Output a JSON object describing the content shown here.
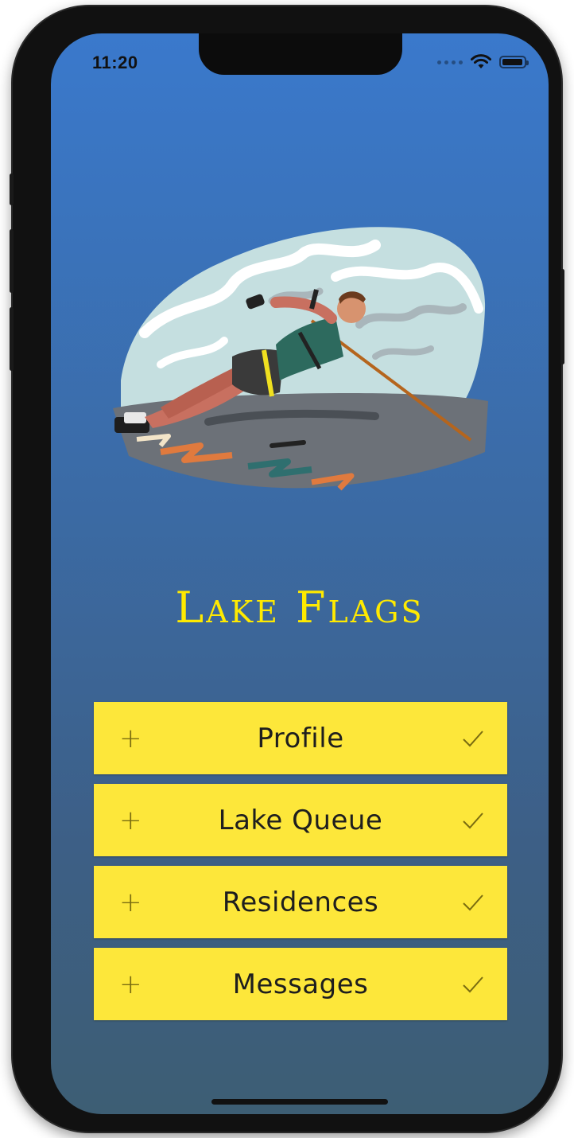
{
  "status_bar": {
    "time": "11:20",
    "icons": [
      "signal-dots-icon",
      "wifi-icon",
      "battery-icon"
    ]
  },
  "hero": {
    "image": "water-skier-illustration"
  },
  "app": {
    "title": "Lake Flags"
  },
  "menu": {
    "items": [
      {
        "label": "Profile",
        "leading_icon": "plus-icon",
        "trailing_icon": "check-icon"
      },
      {
        "label": "Lake Queue",
        "leading_icon": "plus-icon",
        "trailing_icon": "check-icon"
      },
      {
        "label": "Residences",
        "leading_icon": "plus-icon",
        "trailing_icon": "check-icon"
      },
      {
        "label": "Messages",
        "leading_icon": "plus-icon",
        "trailing_icon": "check-icon"
      }
    ]
  },
  "colors": {
    "background_top": "#3a79cc",
    "background_bottom": "#3d5e74",
    "title": "#ffea00",
    "button": "#fde73a",
    "button_text": "#1e1e1e",
    "icon": "#7a6c10"
  }
}
